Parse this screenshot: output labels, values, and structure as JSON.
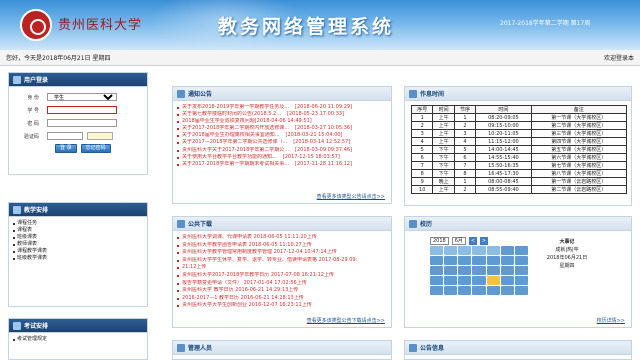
{
  "header": {
    "school": "贵州医科大学",
    "title": "教务网络管理系统",
    "term": "2017-2018学年第二学期 第17周"
  },
  "infobar": {
    "greeting": "您好，今天是2018年06月21日 星期四",
    "welcome": "欢迎登录本"
  },
  "login": {
    "panel_title": "用户登录",
    "identity_label": "身 份",
    "identity_value": "学生",
    "id_label": "学 号",
    "pwd_label": "密 码",
    "code_label": "验证码",
    "login_btn": "登 录",
    "forgot_btn": "忘记密码"
  },
  "teaching": {
    "panel_title": "教学安排",
    "items": [
      "课程任务",
      "课程表",
      "班级课表",
      "教师课表",
      "课程教学课表",
      "班级教学课表"
    ]
  },
  "exam": {
    "panel_title": "考试安排",
    "items": [
      "考试管理规定"
    ]
  },
  "notices": {
    "panel_title": "通知公告",
    "more": "查看更多该类型公告请点击>>",
    "items": [
      {
        "t": "关于发布2018-2019学年第一学期教学任务及...",
        "d": "[2018-06-20 11:09:29]"
      },
      {
        "t": "关于第七教学楼临时封闭的公告(2018.5.2...",
        "d": "[2018-05-23 17:00:33]"
      },
      {
        "t": "2018届毕业生学业成绩复核问题[2018-04-06 14:49:51]",
        "d": ""
      },
      {
        "t": "关于2017-2018学年第二学期校内开放选修课...",
        "d": "[2018-03-27 10:05:36]"
      },
      {
        "t": "关于2018届毕业生办理离校相关事宜通知...",
        "d": "[2018-03-21 15:04:00]"
      },
      {
        "t": "关于2017—2018学年第二学期公共选修课（...",
        "d": "[2018-03-14 12:52:57]"
      },
      {
        "t": "贵州医科大学关于2017-2018学年第二学期公...",
        "d": "[2018-03-09 09:37:46]"
      },
      {
        "t": "关于使用大平台教学平台教学功能的通知...",
        "d": "[2017-12-15 18:03:57]"
      },
      {
        "t": "关于2017-2018学年第一学期期末考试相关事...",
        "d": "[2017-11-28 11:16:12]"
      }
    ]
  },
  "downloads": {
    "panel_title": "公共下载",
    "more": "查看更多该类型公告下载请点击>>",
    "items": [
      {
        "t": "贵州医科大学调课、代课申请表 2018-06-05 11:11:20上传"
      },
      {
        "t": "贵州医科大学教学函告申请表 2018-06-05 11:10:27上传"
      },
      {
        "t": "贵州医科大学教学管理常用制度教学管理 2017-12-04 10:47:14上传"
      },
      {
        "t": "贵州医科大学学生休学、复学、退学、转专业、借读申请表格 2017-08-29 09:"
      },
      {
        "t": "21:12上传"
      },
      {
        "t": "贵州医科大学2017-2018学年教学日历 2017-07-08 16:21:12上传"
      },
      {
        "t": "报告学籍变更申请（文件） 2017-01-04 17:02:56上传"
      },
      {
        "t": "贵州医科大学 教学日历 2016-06-21 14:29:13上传"
      },
      {
        "t": "2016-2017—1 教学日历 2016-06-21 14:28:13上传"
      },
      {
        "t": "贵州医科大学大学生创新创业 2016-12-07 16:23:11上传"
      }
    ]
  },
  "admins": {
    "panel_title": "管理人员"
  },
  "schedule": {
    "panel_title": "作息时间",
    "columns": [
      "序号",
      "时间",
      "节序",
      "时间",
      "备注"
    ],
    "rows": [
      [
        "1",
        "上午",
        "1",
        "08:20-09:05",
        "第一节课（大学城校区）"
      ],
      [
        "2",
        "上午",
        "2",
        "09:15-10:00",
        "第二节课（大学城校区）"
      ],
      [
        "3",
        "上午",
        "3",
        "10:20-11:05",
        "第三节课（大学城校区）"
      ],
      [
        "4",
        "上午",
        "4",
        "11:15-12:00",
        "第四节课（大学城校区）"
      ],
      [
        "5",
        "下午",
        "5",
        "14:00-14:45",
        "第五节课（大学城校区）"
      ],
      [
        "6",
        "下午",
        "6",
        "14:55-15:40",
        "第六节课（大学城校区）"
      ],
      [
        "7",
        "下午",
        "7",
        "15:50-16:35",
        "第七节课（大学城校区）"
      ],
      [
        "8",
        "下午",
        "8",
        "16:45-17:30",
        "第八节课（大学城校区）"
      ],
      [
        "9",
        "晚上",
        "1",
        "08:00-08:45",
        "第一节课（云岩路校区）"
      ],
      [
        "10",
        "上午",
        "2",
        "08:55-09:40",
        "第二节课（云岩路校区）"
      ]
    ]
  },
  "calendar": {
    "panel_title": "校历",
    "year": "2018",
    "month": "6月",
    "event_title": "大事记",
    "event_status": "成就|热|卒",
    "event_date": "2018年06月21日",
    "event_weekday": "星期四",
    "more": "校历详情>>"
  },
  "announce": {
    "panel_title": "公告信息"
  }
}
